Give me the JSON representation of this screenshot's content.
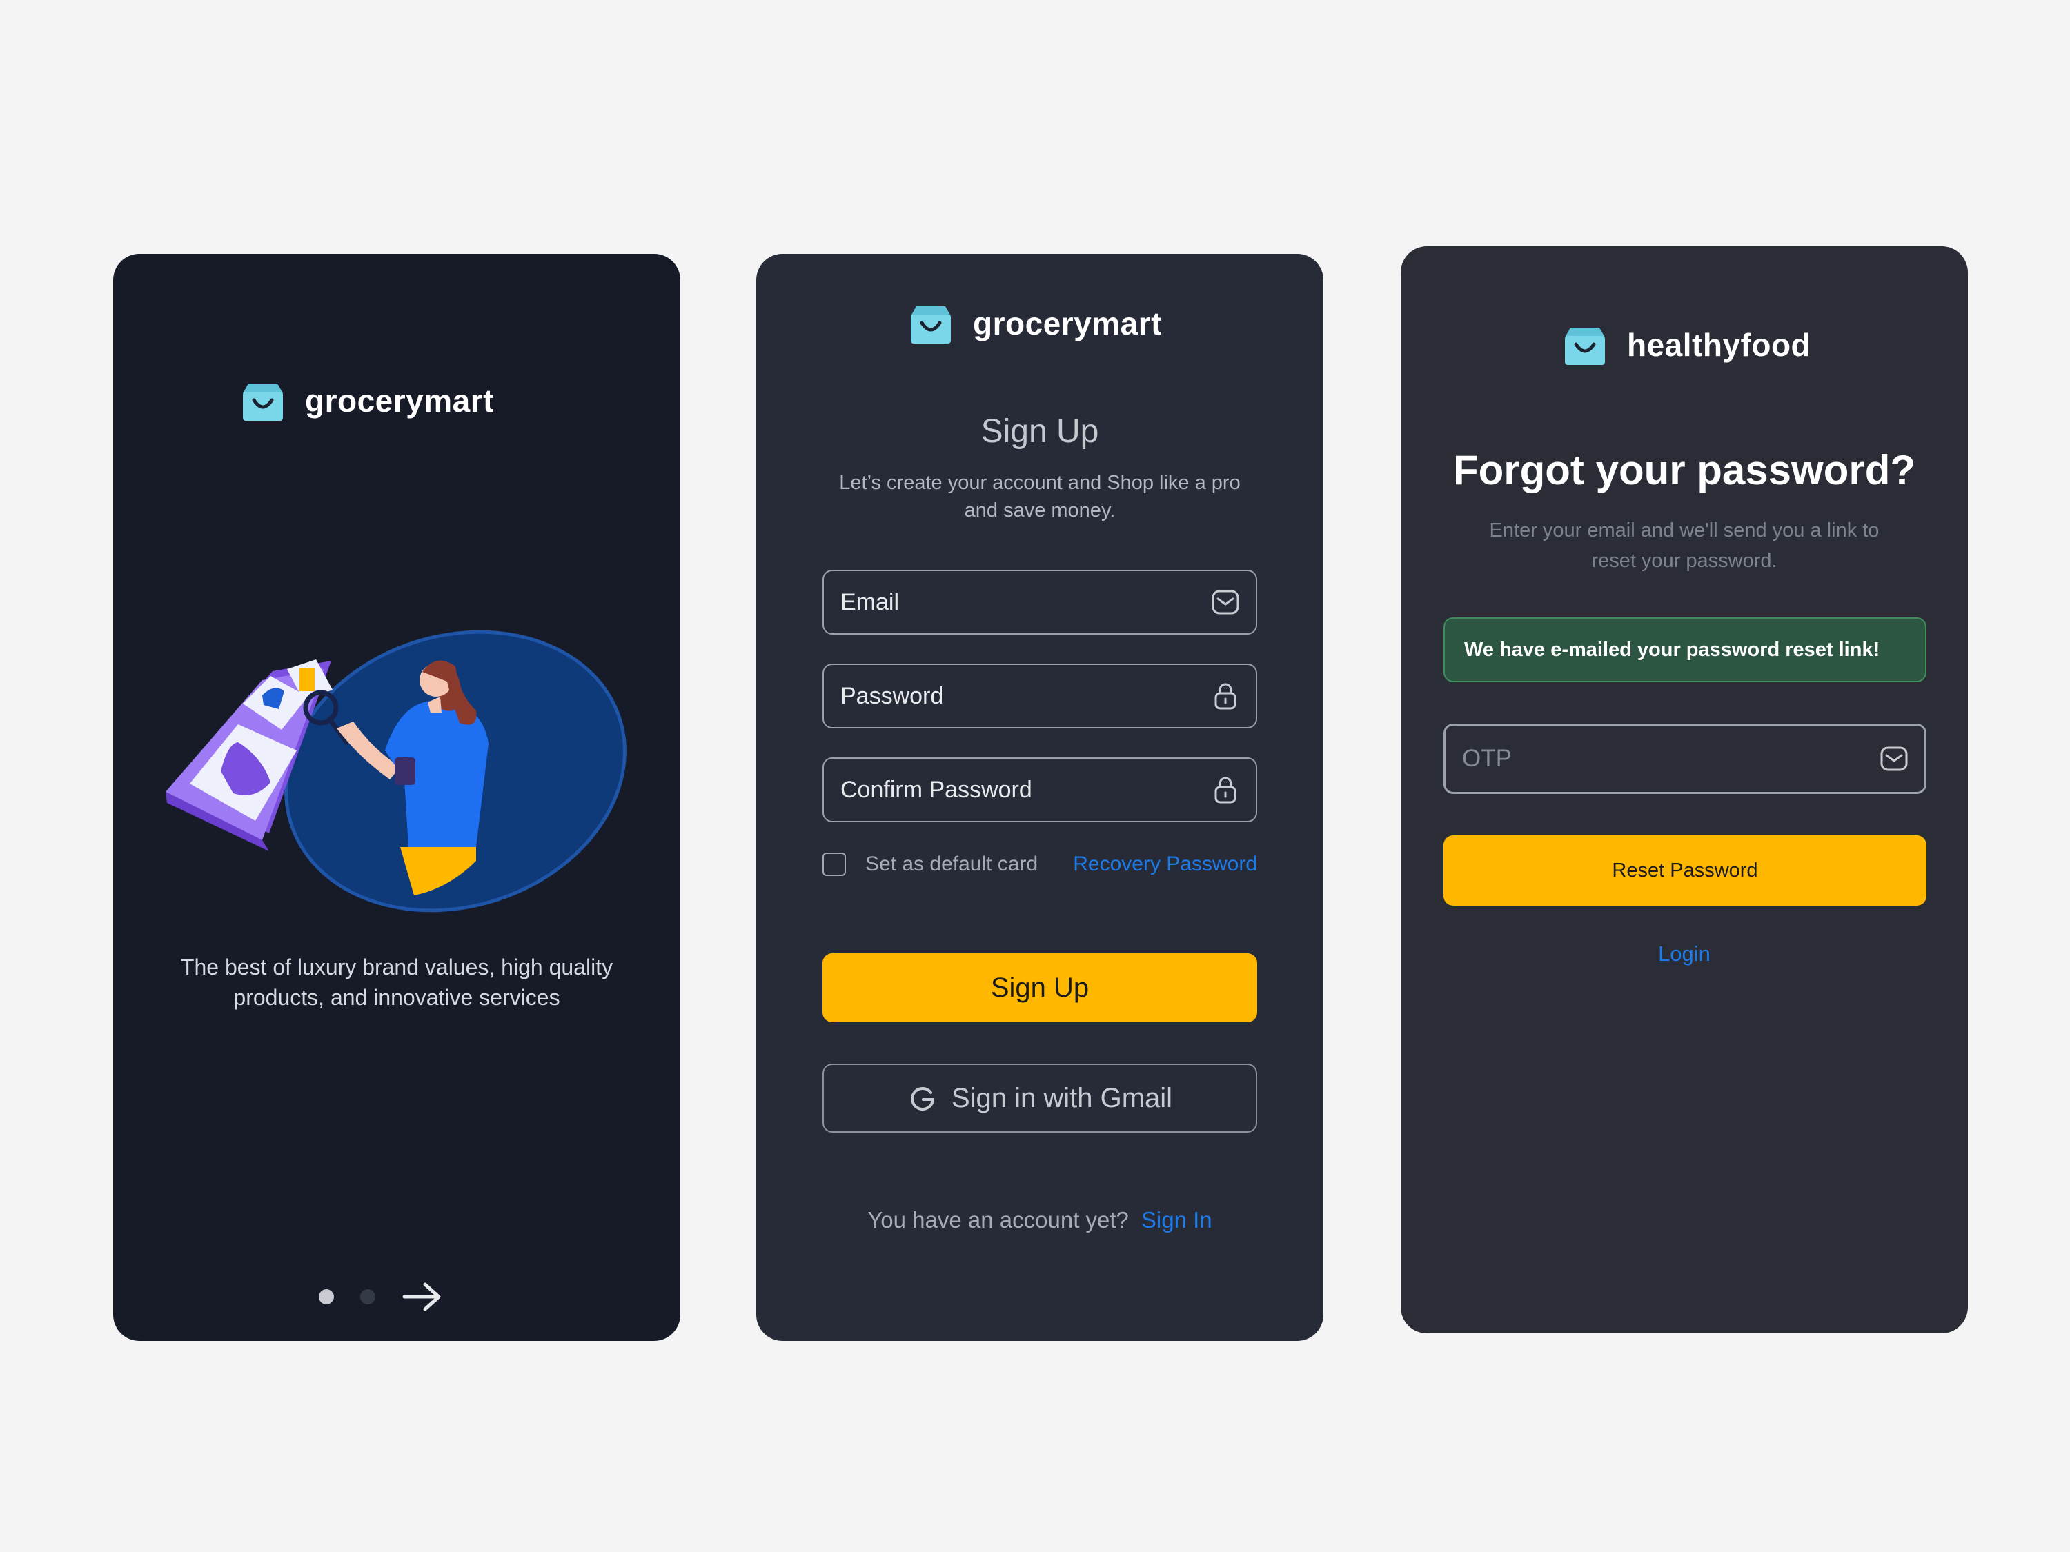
{
  "colors": {
    "page_bg": "#f4f4f4",
    "onboard_card_bg": "#171b27",
    "signup_card_bg": "#272b37",
    "forgot_card_bg": "#2a2d35",
    "accent_yellow": "#ffb700",
    "link_blue": "#1d7ae8",
    "brand_icon": "#7ad7ea",
    "alert_bg": "#2c5542"
  },
  "onboarding": {
    "brand": "grocerymart",
    "brand_icon": "shopping-bag-icon",
    "tagline": "The best of luxury brand values, high quality products, and innovative services",
    "pagination": {
      "current": 1,
      "total": 2
    },
    "next_icon": "arrow-right-icon"
  },
  "signup": {
    "brand": "grocerymart",
    "title": "Sign Up",
    "subtitle": "Let’s create your account and  Shop like a pro and save money.",
    "email_label": "Email",
    "email_icon": "mail-icon",
    "password_label": "Password",
    "password_icon": "lock-icon",
    "confirm_label": "Confirm Password",
    "checkbox_label": "Set as default card",
    "recovery_link": "Recovery Password",
    "submit_label": "Sign Up",
    "google_label": "Sign in with Gmail",
    "google_icon": "google-g-icon",
    "footer_text": "You have an account yet?",
    "footer_link": "Sign In"
  },
  "forgot": {
    "brand": "healthyfood",
    "title": "Forgot your password?",
    "subtitle": "Enter your email and we'll send you a link to reset your password.",
    "alert": "We have e-mailed your password reset link!",
    "otp_placeholder": "OTP",
    "otp_icon": "mail-icon",
    "reset_label": "Reset Password",
    "login_link": "Login"
  }
}
